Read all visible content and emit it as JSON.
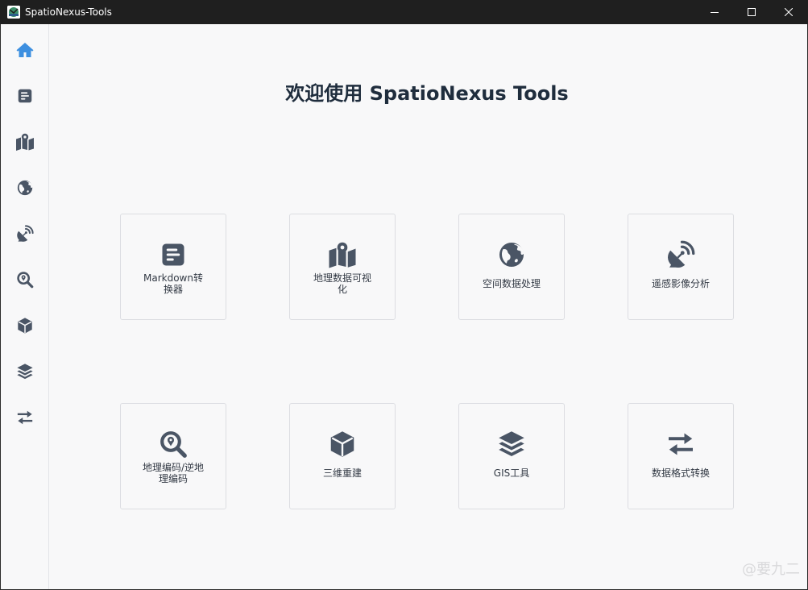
{
  "window": {
    "title": "SpatioNexus-Tools",
    "icon": "app-logo-icon"
  },
  "window_controls": [
    "minimize-icon",
    "maximize-icon",
    "close-icon"
  ],
  "sidebar": {
    "items": [
      {
        "id": "home",
        "icon": "home-icon",
        "active": true
      },
      {
        "id": "markdown",
        "icon": "document-icon"
      },
      {
        "id": "geo-visualization",
        "icon": "map-icon"
      },
      {
        "id": "spatial-data",
        "icon": "globe-icon"
      },
      {
        "id": "remote-sensing",
        "icon": "satellite-dish-icon"
      },
      {
        "id": "geocoding",
        "icon": "search-location-icon"
      },
      {
        "id": "3d-reconstruction",
        "icon": "cube-icon"
      },
      {
        "id": "gis-tools",
        "icon": "layers-icon"
      },
      {
        "id": "format-conversion",
        "icon": "exchange-icon"
      }
    ]
  },
  "main": {
    "welcome_title": "欢迎使用 SpatioNexus Tools",
    "cards": [
      {
        "icon": "document-icon",
        "label_line1": "Markdown转",
        "label_line2": "换器"
      },
      {
        "icon": "map-icon",
        "label_line1": "地理数据可视",
        "label_line2": "化"
      },
      {
        "icon": "globe-icon",
        "label": "空间数据处理"
      },
      {
        "icon": "satellite-dish-icon",
        "label": "遥感影像分析"
      },
      {
        "icon": "search-location-icon",
        "label_line1": "地理编码/逆地",
        "label_line2": "理编码"
      },
      {
        "icon": "cube-icon",
        "label": "三维重建"
      },
      {
        "icon": "layers-icon",
        "label": "GIS工具"
      },
      {
        "icon": "exchange-icon",
        "label": "数据格式转换"
      }
    ]
  },
  "watermark": "@要九二",
  "colors": {
    "accent": "#3d8fe0",
    "icon": "#4a5565",
    "titlebar": "#1f1f1f",
    "background": "#f8f8f9"
  }
}
